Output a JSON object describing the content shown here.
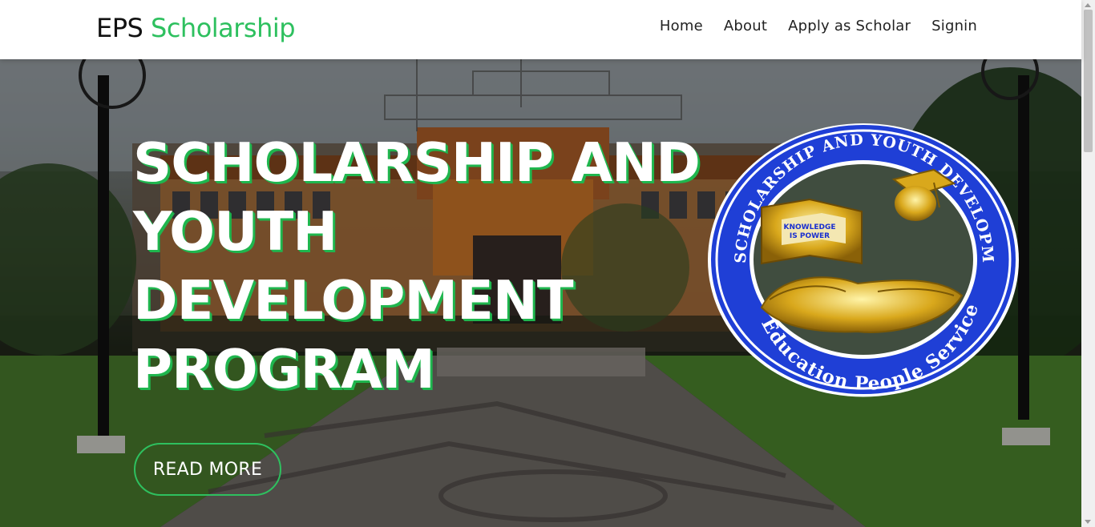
{
  "brand": {
    "part1": "EPS",
    "part2": "Scholarship"
  },
  "nav": [
    {
      "label": "Home"
    },
    {
      "label": "About"
    },
    {
      "label": "Apply as Scholar"
    },
    {
      "label": "Signin"
    }
  ],
  "hero": {
    "headline_lines": [
      "SCHOLARSHIP AND",
      "YOUTH",
      "DEVELOPMENT",
      "PROGRAM"
    ],
    "cta_label": "READ MORE"
  },
  "seal": {
    "ring_top_text": "SCHOLARSHIP AND YOUTH DEVELOPMENT PROGRAM",
    "ring_bottom_text": "Education People Service",
    "book_text_1": "KNOWLEDGE",
    "book_text_2": "IS POWER"
  },
  "colors": {
    "accent": "#2ec05f",
    "seal_blue": "#1e3fd6"
  }
}
